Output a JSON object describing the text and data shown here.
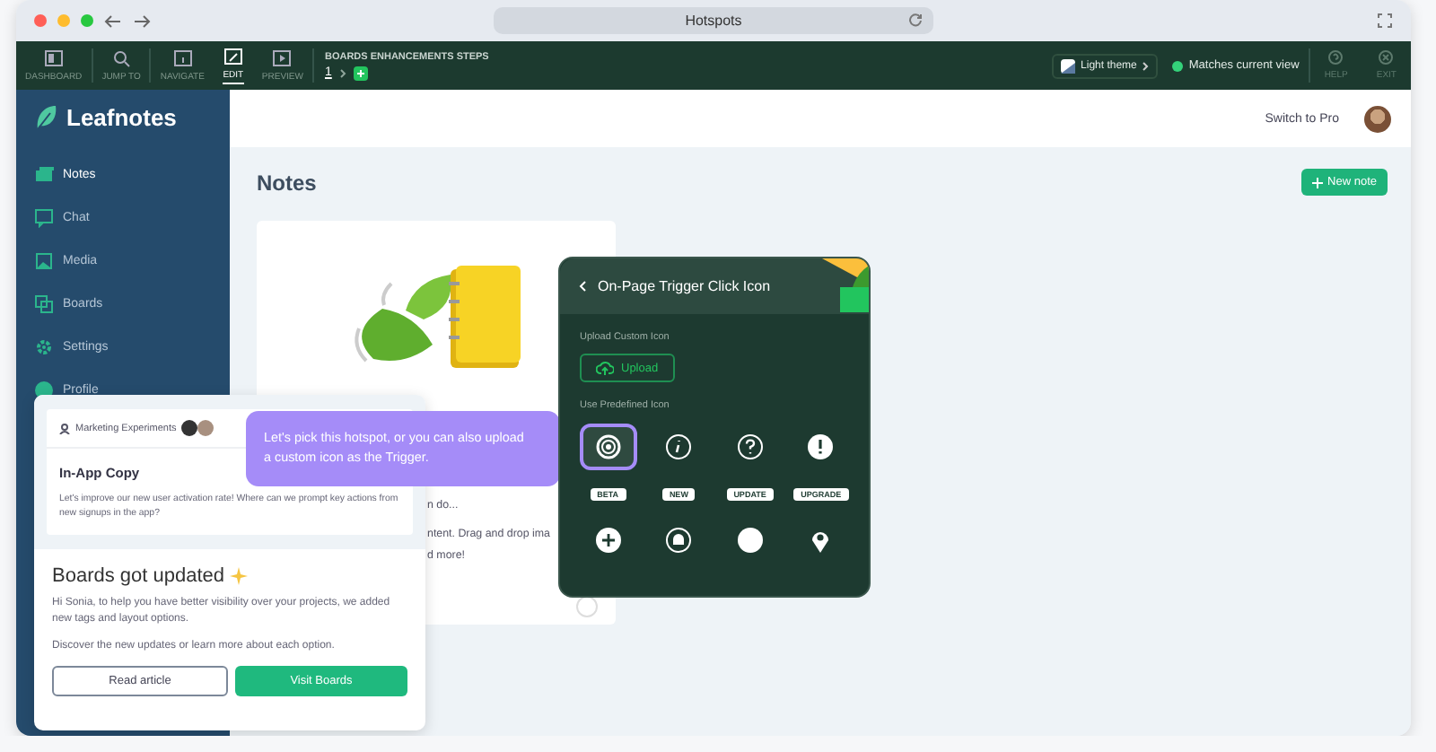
{
  "browser": {
    "address": "Hotspots"
  },
  "toolbar": {
    "tools": [
      {
        "kind": "dashboard",
        "label": "DASHBOARD",
        "selected": false
      },
      {
        "kind": "jump",
        "label": "JUMP TO",
        "selected": false
      },
      {
        "kind": "navigate",
        "label": "NAVIGATE",
        "selected": false
      },
      {
        "kind": "edit",
        "label": "EDIT",
        "selected": true
      },
      {
        "kind": "preview",
        "label": "PREVIEW",
        "selected": false
      }
    ],
    "flow_title": "BOARDS ENHANCEMENTS STEPS",
    "step": "1",
    "theme": "Light theme",
    "status": "Matches current view",
    "actions": [
      {
        "kind": "help",
        "label": "HELP"
      },
      {
        "kind": "exit",
        "label": "EXIT"
      }
    ]
  },
  "app": {
    "logo": "Leafnotes",
    "sidebar": {
      "items": [
        {
          "kind": "notes",
          "label": "Notes",
          "selected": true
        },
        {
          "kind": "chat",
          "label": "Chat",
          "selected": false
        },
        {
          "kind": "media",
          "label": "Media",
          "selected": false
        },
        {
          "kind": "boards",
          "label": "Boards",
          "selected": false
        },
        {
          "kind": "settings",
          "label": "Settings",
          "selected": false
        },
        {
          "kind": "profile",
          "label": "Profile",
          "selected": false
        }
      ]
    },
    "header": {
      "link": "Switch to Pro"
    },
    "page_title": "Notes",
    "new_button": "New note",
    "note_card": {
      "lines": [
        "n do...",
        "ntent. Drag and drop ima",
        "d more!"
      ]
    }
  },
  "announcement": {
    "inner": {
      "workspace": "Marketing Experiments",
      "title": "In-App Copy",
      "body": "Let's improve our new user activation rate! Where can we prompt key actions from new signups in the app?"
    },
    "title": "Boards got updated",
    "paragraphs": [
      "Hi Sonia, to help you have better visibility over your projects, we added new tags and layout options.",
      "Discover the new updates or learn more about each option."
    ],
    "buttons": [
      {
        "kind": "secondary",
        "label": "Read article"
      },
      {
        "kind": "primary",
        "label": "Visit Boards"
      }
    ]
  },
  "tooltip": {
    "text": "Let's pick this hotspot, or you can also upload a custom icon as the Trigger."
  },
  "trigger_panel": {
    "title": "On-Page Trigger Click Icon",
    "upload_label": "Upload Custom Icon",
    "upload_button": "Upload",
    "predefined_label": "Use Predefined Icon",
    "icons": [
      {
        "kind": "target",
        "selected": true
      },
      {
        "kind": "info",
        "selected": false
      },
      {
        "kind": "question",
        "selected": false
      },
      {
        "kind": "alert",
        "selected": false
      },
      {
        "kind": "badge",
        "text": "BETA",
        "selected": false
      },
      {
        "kind": "badge",
        "text": "NEW",
        "selected": false
      },
      {
        "kind": "badge",
        "text": "UPDATE",
        "selected": false
      },
      {
        "kind": "badge",
        "text": "UPGRADE",
        "selected": false
      },
      {
        "kind": "plus",
        "selected": false
      },
      {
        "kind": "bell",
        "selected": false
      },
      {
        "kind": "dot",
        "selected": false
      },
      {
        "kind": "pin",
        "selected": false
      }
    ]
  }
}
